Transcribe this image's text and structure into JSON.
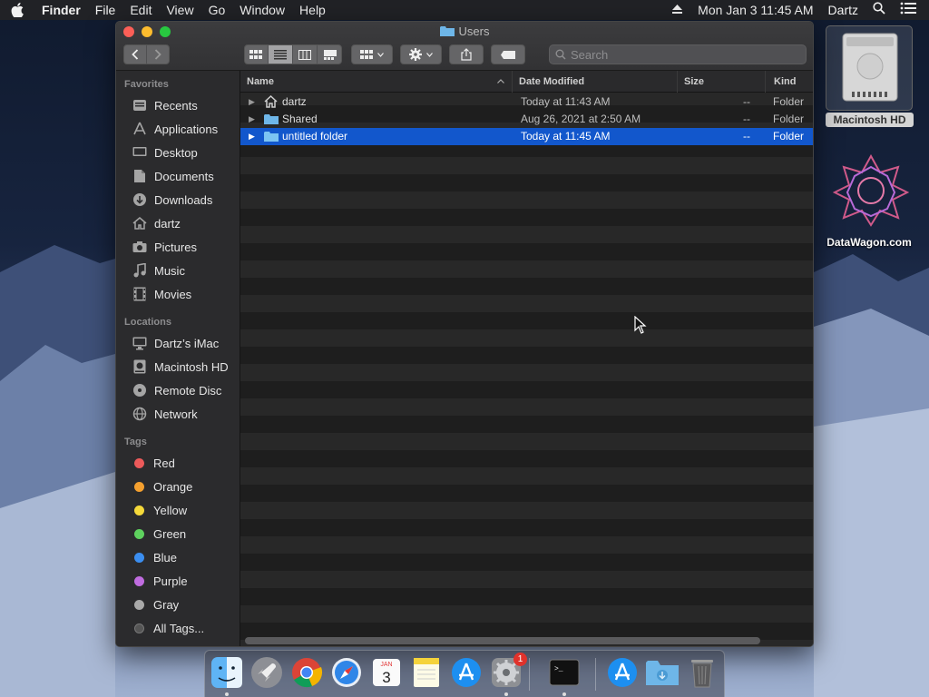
{
  "menubar": {
    "app": "Finder",
    "menus": [
      "File",
      "Edit",
      "View",
      "Go",
      "Window",
      "Help"
    ],
    "datetime": "Mon Jan 3  11:45 AM",
    "user": "Dartz"
  },
  "window": {
    "title": "Users",
    "search_placeholder": "Search"
  },
  "sidebar": {
    "favorites_header": "Favorites",
    "favorites": [
      "Recents",
      "Applications",
      "Desktop",
      "Documents",
      "Downloads",
      "dartz",
      "Pictures",
      "Music",
      "Movies"
    ],
    "locations_header": "Locations",
    "locations": [
      "Dartz’s iMac",
      "Macintosh HD",
      "Remote Disc",
      "Network"
    ],
    "tags_header": "Tags",
    "tags": [
      {
        "label": "Red",
        "color": "#ec5a5a"
      },
      {
        "label": "Orange",
        "color": "#f5a02f"
      },
      {
        "label": "Yellow",
        "color": "#f5d93a"
      },
      {
        "label": "Green",
        "color": "#5ed15e"
      },
      {
        "label": "Blue",
        "color": "#3b8ef0"
      },
      {
        "label": "Purple",
        "color": "#c06ce0"
      },
      {
        "label": "Gray",
        "color": "#a9a9a9"
      },
      {
        "label": "All Tags...",
        "color": "#555555"
      }
    ]
  },
  "columns": {
    "name": "Name",
    "date": "Date Modified",
    "size": "Size",
    "kind": "Kind"
  },
  "files": [
    {
      "name": "dartz",
      "date": "Today at 11:43 AM",
      "size": "--",
      "kind": "Folder",
      "icon": "home-folder-icon",
      "selected": false
    },
    {
      "name": "Shared",
      "date": "Aug 26, 2021 at 2:50 AM",
      "size": "--",
      "kind": "Folder",
      "icon": "folder-icon",
      "selected": false
    },
    {
      "name": "untitled folder",
      "date": "Today at 11:45 AM",
      "size": "--",
      "kind": "Folder",
      "icon": "folder-icon",
      "selected": true
    }
  ],
  "desktop": {
    "hd_label": "Macintosh HD",
    "logo_label": "DataWagon.com"
  },
  "dock": {
    "items": [
      "Finder",
      "Launchpad",
      "Google Chrome",
      "Safari",
      "Calendar",
      "Notes",
      "App Store",
      "System Preferences",
      "Terminal",
      "Applications",
      "Downloads",
      "Trash"
    ],
    "calendar_month": "JAN",
    "calendar_day": "3",
    "sysprefs_badge": "1"
  }
}
